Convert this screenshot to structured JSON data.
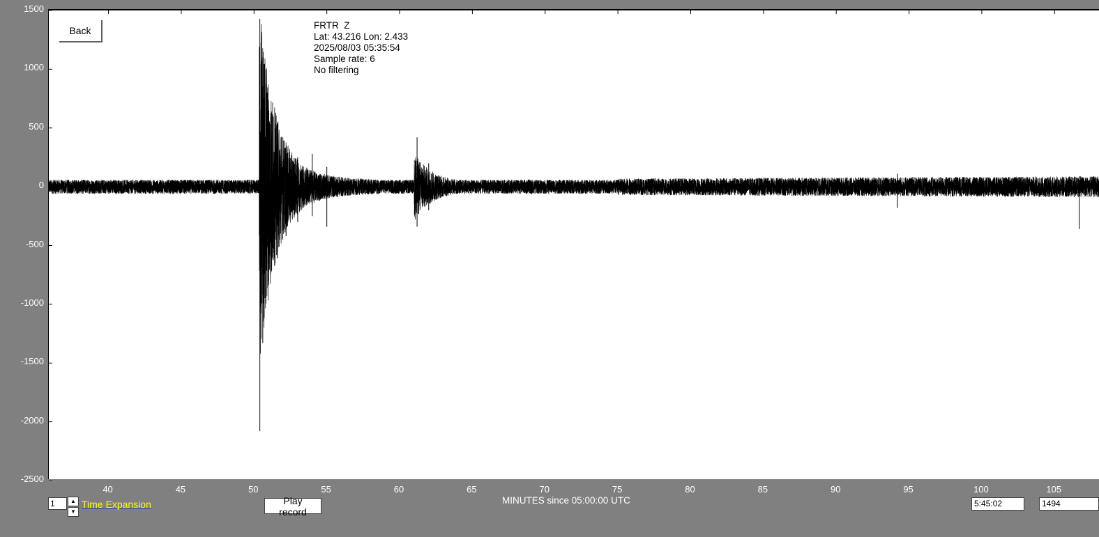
{
  "station_info": {
    "station": "FRTR  Z",
    "location": "Lat: 43.216 Lon: 2.433",
    "datetime": "2025/08/03 05:35:54",
    "sample_rate": "Sample rate: 6",
    "filter": "No filtering"
  },
  "buttons": {
    "back": "Back",
    "play_record": "Play record"
  },
  "controls": {
    "time_expansion_value": "1",
    "time_expansion_label": "Time Expansion",
    "time_display": "5:45:02",
    "count_display": "1494"
  },
  "colors": {
    "background": "#808080",
    "plot_background": "#ffffff",
    "trace": "#000000",
    "time_expansion_label": "#ffff00"
  },
  "chart_data": {
    "type": "line",
    "title": "",
    "xlabel": "MINUTES since 05:00:00 UTC",
    "ylabel": "",
    "xlim": [
      35.9,
      108.1
    ],
    "ylim": [
      -2500,
      1500
    ],
    "x_ticks": [
      40,
      45,
      50,
      55,
      60,
      65,
      70,
      75,
      80,
      85,
      90,
      95,
      100,
      105
    ],
    "y_ticks": [
      1500,
      1000,
      500,
      0,
      -500,
      -1000,
      -1500,
      -2000,
      -2500
    ],
    "grid": false,
    "series": [
      {
        "background_noise_amplitude": 60,
        "events": [
          {
            "x": 50.4,
            "min": -2080,
            "max": 1430
          },
          {
            "x": 50.6,
            "min": -1330,
            "max": 1100
          },
          {
            "x": 50.9,
            "min": -860,
            "max": 800
          },
          {
            "x": 51.2,
            "min": -720,
            "max": 640
          },
          {
            "x": 51.6,
            "min": -610,
            "max": 430
          },
          {
            "x": 52.2,
            "min": -420,
            "max": 330
          },
          {
            "x": 53.0,
            "min": -300,
            "max": 250
          },
          {
            "x": 54.0,
            "min": -250,
            "max": 280
          },
          {
            "x": 55.0,
            "min": -340,
            "max": 170
          },
          {
            "x": 61.2,
            "min": -340,
            "max": 420
          },
          {
            "x": 62.0,
            "min": -200,
            "max": 200
          },
          {
            "x": 94.2,
            "min": -180,
            "max": 110
          },
          {
            "x": 106.7,
            "min": -360,
            "max": 90
          }
        ]
      }
    ]
  }
}
